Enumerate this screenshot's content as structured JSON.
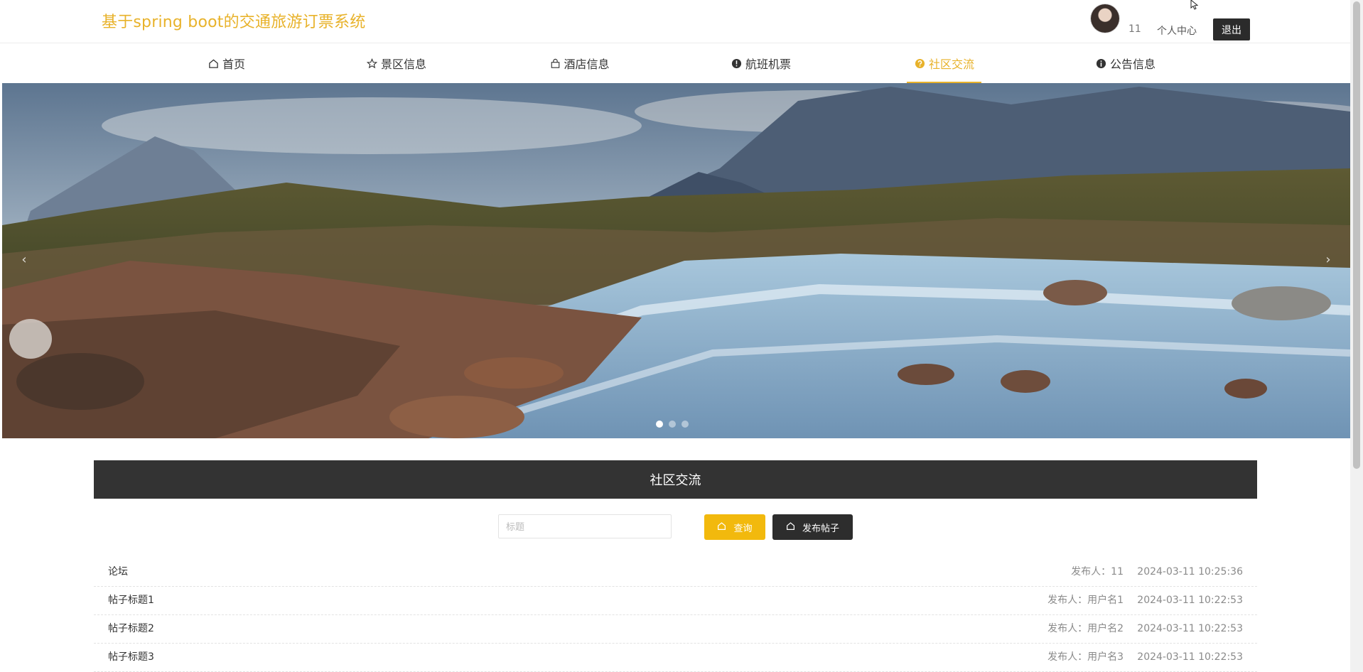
{
  "header": {
    "site_title": "基于spring boot的交通旅游订票系统",
    "user_name": "11",
    "center_label": "个人中心",
    "logout_label": "退出",
    "accent_color": "#e8b22a"
  },
  "nav": {
    "items": [
      {
        "label": "首页",
        "icon": "home-icon"
      },
      {
        "label": "景区信息",
        "icon": "star-icon"
      },
      {
        "label": "酒店信息",
        "icon": "bag-icon"
      },
      {
        "label": "航班机票",
        "icon": "alert-icon"
      },
      {
        "label": "社区交流",
        "icon": "question-icon",
        "active": true
      },
      {
        "label": "公告信息",
        "icon": "info-icon"
      }
    ]
  },
  "banner": {
    "prev_glyph": "‹",
    "next_glyph": "›",
    "slides": 3,
    "active_slide": 1
  },
  "section": {
    "title": "社区交流"
  },
  "search": {
    "placeholder": "标题",
    "value": "",
    "search_label": "查询",
    "post_label": "发布帖子",
    "search_color": "#f2b90d",
    "post_color": "#2d2d2d"
  },
  "posts": [
    {
      "title": "论坛",
      "author": "发布人：11",
      "time": "2024-03-11 10:25:36"
    },
    {
      "title": "帖子标题1",
      "author": "发布人：用户名1",
      "time": "2024-03-11 10:22:53"
    },
    {
      "title": "帖子标题2",
      "author": "发布人：用户名2",
      "time": "2024-03-11 10:22:53"
    },
    {
      "title": "帖子标题3",
      "author": "发布人：用户名3",
      "time": "2024-03-11 10:22:53"
    }
  ]
}
